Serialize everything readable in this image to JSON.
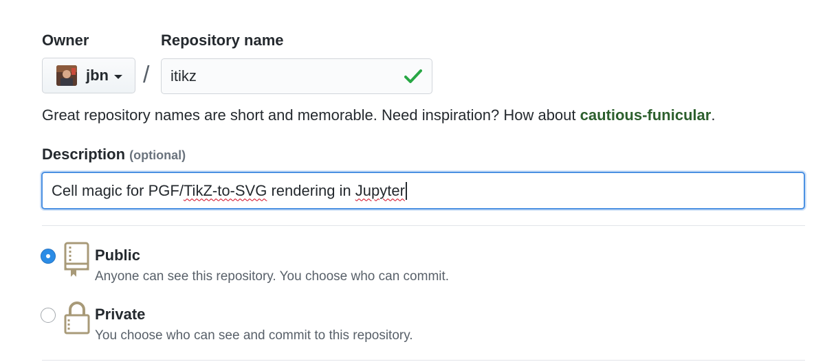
{
  "owner": {
    "label": "Owner",
    "selected": "jbn"
  },
  "repository": {
    "label": "Repository name",
    "value": "itikz"
  },
  "name_help": {
    "text": "Great repository names are short and memorable. Need inspiration? How about ",
    "suggestion": "cautious-funicular",
    "end": "."
  },
  "description": {
    "label": "Description",
    "optional": "(optional)",
    "value_parts": [
      "Cell magic for PGF/",
      "TikZ-to-SVG",
      " rendering in ",
      "Jupyter"
    ]
  },
  "visibility": {
    "public": {
      "title": "Public",
      "description": "Anyone can see this repository. You choose who can commit.",
      "checked": true,
      "icon": "repo-book-icon"
    },
    "private": {
      "title": "Private",
      "description": "You choose who can see and commit to this repository.",
      "checked": false,
      "icon": "lock-icon"
    }
  },
  "colors": {
    "accent_blue": "#2b8ce6",
    "success_green": "#28a745",
    "suggestion_green": "#2c5f2d",
    "icon_tan": "#a89a78"
  }
}
